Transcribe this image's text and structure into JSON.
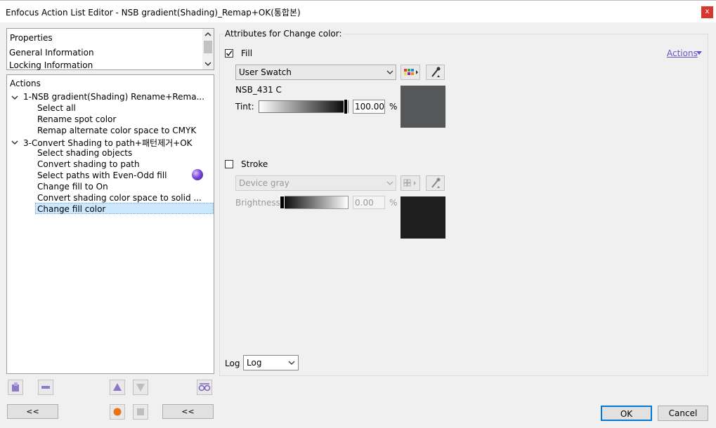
{
  "window": {
    "title": "Enfocus Action List Editor - NSB gradient(Shading)_Remap+OK(통합본)",
    "close_label": "x"
  },
  "properties": {
    "header": "Properties",
    "items": [
      "General Information",
      "Locking Information"
    ]
  },
  "actions": {
    "header": "Actions",
    "groups": [
      {
        "label": "1-NSB gradient(Shading) Rename+Rema...",
        "children": [
          "Select all",
          "Rename spot color",
          "Remap alternate color space to CMYK"
        ]
      },
      {
        "label": "3-Convert Shading to path+패턴제거+OK",
        "children": [
          "Select shading objects",
          "Convert shading to path",
          "Select paths with Even-Odd fill",
          "Change fill to On",
          "Convert shading color space to solid ...",
          "Change fill color"
        ]
      }
    ],
    "selected": "Change fill color"
  },
  "bottom_buttons": {
    "left_back": "<<",
    "right_back": "<<"
  },
  "attributes": {
    "group_title": "Attributes for Change color:",
    "actions_link": "Actions",
    "fill": {
      "label": "Fill",
      "checked": true,
      "color_mode": "User Swatch",
      "swatch_name": "NSB_431 C",
      "tint_label": "Tint:",
      "tint_value": "100.00",
      "percent": "%",
      "swatch_color": "#545859"
    },
    "stroke": {
      "label": "Stroke",
      "checked": false,
      "color_mode": "Device gray",
      "brightness_label": "Brightness",
      "brightness_value": "0.00",
      "percent": "%",
      "swatch_color": "#1e1e1e"
    }
  },
  "log": {
    "label": "Log",
    "value": "Log"
  },
  "dialog_buttons": {
    "ok": "OK",
    "cancel": "Cancel"
  }
}
